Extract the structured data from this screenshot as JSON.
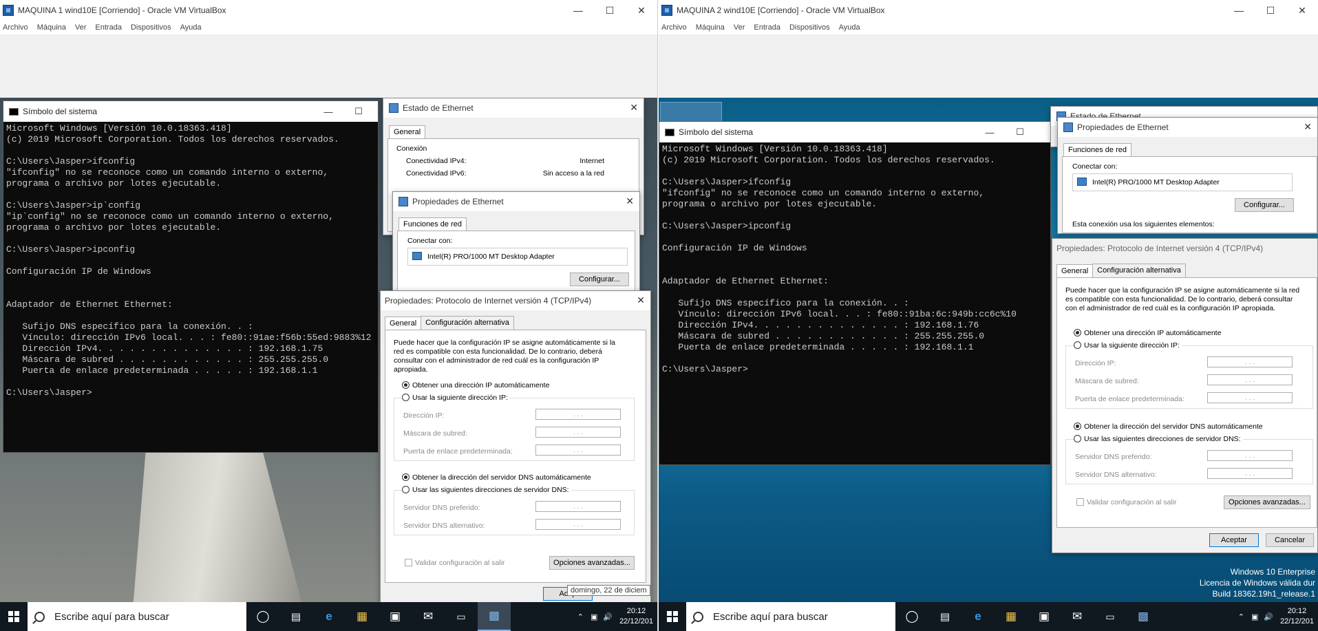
{
  "vm1": {
    "title": "MAQUINA 1 wind10E [Corriendo] - Oracle VM VirtualBox",
    "menu": [
      "Archivo",
      "Máquina",
      "Ver",
      "Entrada",
      "Dispositivos",
      "Ayuda"
    ],
    "cmd": {
      "title": "Símbolo del sistema",
      "lines": [
        "Microsoft Windows [Versión 10.0.18363.418]",
        "(c) 2019 Microsoft Corporation. Todos los derechos reservados.",
        "",
        "C:\\Users\\Jasper>ifconfig",
        "\"ifconfig\" no se reconoce como un comando interno o externo,",
        "programa o archivo por lotes ejecutable.",
        "",
        "C:\\Users\\Jasper>ip`config",
        "\"ip`config\" no se reconoce como un comando interno o externo,",
        "programa o archivo por lotes ejecutable.",
        "",
        "C:\\Users\\Jasper>ipconfig",
        "",
        "Configuración IP de Windows",
        "",
        "",
        "Adaptador de Ethernet Ethernet:",
        "",
        "   Sufijo DNS específico para la conexión. . :",
        "   Vínculo: dirección IPv6 local. . . : fe80::91ae:f56b:55ed:9883%12",
        "   Dirección IPv4. . . . . . . . . . . . . . : 192.168.1.75",
        "   Máscara de subred . . . . . . . . . . . . : 255.255.255.0",
        "   Puerta de enlace predeterminada . . . . . : 192.168.1.1",
        "",
        "C:\\Users\\Jasper>"
      ]
    },
    "estado": {
      "title": "Estado de Ethernet",
      "tab": "General",
      "section": "Conexión",
      "rows": [
        {
          "label": "Conectividad IPv4:",
          "value": "Internet"
        },
        {
          "label": "Conectividad IPv6:",
          "value": "Sin acceso a la red"
        }
      ]
    },
    "props": {
      "title": "Propiedades de Ethernet",
      "tab": "Funciones de red",
      "connect_label": "Conectar con:",
      "adapter": "Intel(R) PRO/1000 MT Desktop Adapter",
      "configure": "Configurar..."
    },
    "tcp": {
      "title": "Propiedades: Protocolo de Internet versión 4 (TCP/IPv4)",
      "tab_general": "General",
      "tab_alt": "Configuración alternativa",
      "description": "Puede hacer que la configuración IP se asigne automáticamente si la red es compatible con esta funcionalidad. De lo contrario, deberá consultar con el administrador de red cuál es la configuración IP apropiada.",
      "auto_ip": "Obtener una dirección IP automáticamente",
      "manual_ip": "Usar la siguiente dirección IP:",
      "ip_label": "Dirección IP:",
      "mask_label": "Máscara de subred:",
      "gateway_label": "Puerta de enlace predeterminada:",
      "auto_dns": "Obtener la dirección del servidor DNS automáticamente",
      "manual_dns": "Usar las siguientes direcciones de servidor DNS:",
      "dns_pref": "Servidor DNS preferido:",
      "dns_alt": "Servidor DNS alternativo:",
      "validate": "Validar configuración al salir",
      "advanced": "Opciones avanzadas...",
      "ok": "Acep"
    },
    "tooltip": "domingo, 22 de diciem",
    "taskbar": {
      "search": "Escribe aquí para buscar",
      "time": "20:12",
      "date": "22/12/201"
    }
  },
  "vm2": {
    "title": "MAQUINA 2 wind10E [Corriendo] - Oracle VM VirtualBox",
    "menu": [
      "Archivo",
      "Máquina",
      "Ver",
      "Entrada",
      "Dispositivos",
      "Ayuda"
    ],
    "cmd": {
      "title": "Símbolo del sistema",
      "lines": [
        "Microsoft Windows [Versión 10.0.18363.418]",
        "(c) 2019 Microsoft Corporation. Todos los derechos reservados.",
        "",
        "C:\\Users\\Jasper>ifconfig",
        "\"ifconfig\" no se reconoce como un comando interno o externo,",
        "programa o archivo por lotes ejecutable.",
        "",
        "C:\\Users\\Jasper>ipconfig",
        "",
        "Configuración IP de Windows",
        "",
        "",
        "Adaptador de Ethernet Ethernet:",
        "",
        "   Sufijo DNS específico para la conexión. . :",
        "   Vínculo: dirección IPv6 local. . . : fe80::91ba:6c:949b:cc6c%10",
        "   Dirección IPv4. . . . . . . . . . . . . . : 192.168.1.76",
        "   Máscara de subred . . . . . . . . . . . . : 255.255.255.0",
        "   Puerta de enlace predeterminada . . . . . : 192.168.1.1",
        "",
        "C:\\Users\\Jasper>"
      ]
    },
    "estado_title": "Estado de Ethernet",
    "props": {
      "title": "Propiedades de Ethernet",
      "tab": "Funciones de red",
      "connect_label": "Conectar con:",
      "adapter": "Intel(R) PRO/1000 MT Desktop Adapter",
      "configure": "Configurar...",
      "uses": "Esta conexión usa los siguientes elementos:"
    },
    "tcp": {
      "title": "Propiedades: Protocolo de Internet versión 4 (TCP/IPv4)",
      "tab_general": "General",
      "tab_alt": "Configuración alternativa",
      "description": "Puede hacer que la configuración IP se asigne automáticamente si la red es compatible con esta funcionalidad. De lo contrario, deberá consultar con el administrador de red cuál es la configuración IP apropiada.",
      "auto_ip": "Obtener una dirección IP automáticamente",
      "manual_ip": "Usar la siguiente dirección IP:",
      "ip_label": "Dirección IP:",
      "mask_label": "Máscara de subred:",
      "gateway_label": "Puerta de enlace predeterminada:",
      "auto_dns": "Obtener la dirección del servidor DNS automáticamente",
      "manual_dns": "Usar las siguientes direcciones de servidor DNS:",
      "dns_pref": "Servidor DNS preferido:",
      "dns_alt": "Servidor DNS alternativo:",
      "validate": "Validar configuración al salir",
      "advanced": "Opciones avanzadas...",
      "ok": "Aceptar",
      "cancel": "Cancelar"
    },
    "activation": [
      "Windows 10 Enterprise",
      "Licencia de Windows válida dur",
      "Build 18362.19h1_release.1"
    ],
    "taskbar": {
      "search": "Escribe aquí para buscar",
      "time": "20:12",
      "date": "22/12/201"
    }
  },
  "ip_field_dots": ". . ."
}
